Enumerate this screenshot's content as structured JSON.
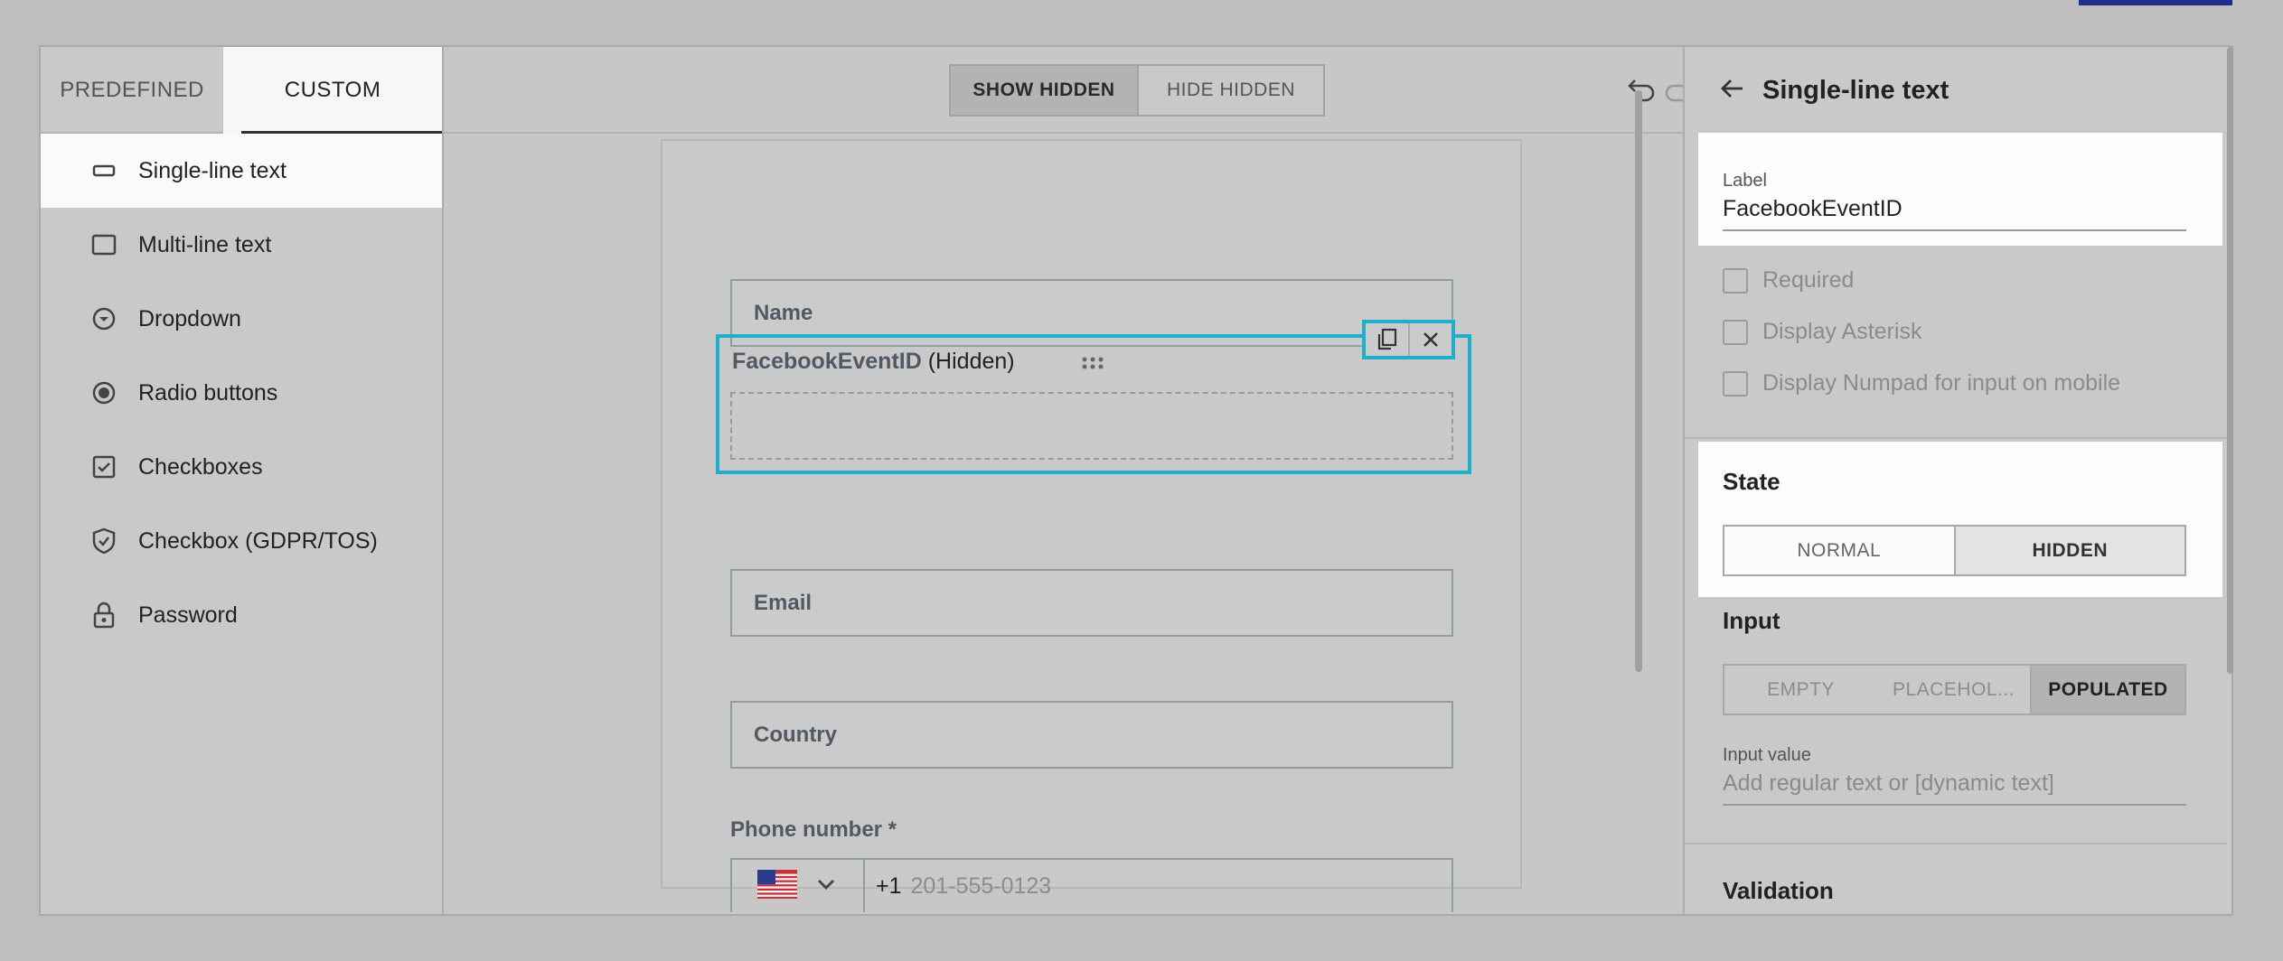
{
  "left_panel": {
    "tabs": {
      "predefined": "PREDEFINED",
      "custom": "CUSTOM"
    },
    "items": [
      {
        "label": "Single-line text",
        "icon": "single-line-icon"
      },
      {
        "label": "Multi-line text",
        "icon": "multi-line-icon"
      },
      {
        "label": "Dropdown",
        "icon": "dropdown-icon"
      },
      {
        "label": "Radio buttons",
        "icon": "radio-icon"
      },
      {
        "label": "Checkboxes",
        "icon": "checkbox-icon"
      },
      {
        "label": "Checkbox (GDPR/TOS)",
        "icon": "shield-check-icon"
      },
      {
        "label": "Password",
        "icon": "lock-icon"
      }
    ]
  },
  "toolbar": {
    "show_hidden": "SHOW HIDDEN",
    "hide_hidden": "HIDE HIDDEN"
  },
  "form": {
    "name_placeholder": "Name",
    "selected_field": {
      "name": "FacebookEventID",
      "suffix": "(Hidden)"
    },
    "email_placeholder": "Email",
    "country_placeholder": "Country",
    "phone": {
      "label": "Phone number *",
      "code": "+1",
      "placeholder": "201-555-0123"
    }
  },
  "settings": {
    "title": "Single-line text",
    "label": {
      "caption": "Label",
      "value": "FacebookEventID"
    },
    "checks": [
      "Required",
      "Display Asterisk",
      "Display Numpad for input on mobile"
    ],
    "state": {
      "title": "State",
      "normal": "NORMAL",
      "hidden": "HIDDEN"
    },
    "input": {
      "title": "Input",
      "empty": "EMPTY",
      "placeholder": "PLACEHOL...",
      "populated": "POPULATED"
    },
    "input_value": {
      "caption": "Input value",
      "placeholder": "Add regular text or [dynamic text]"
    },
    "validation": "Validation"
  },
  "colors": {
    "selection": "#1cb0cc",
    "accent_bar": "#1f2e8e"
  }
}
